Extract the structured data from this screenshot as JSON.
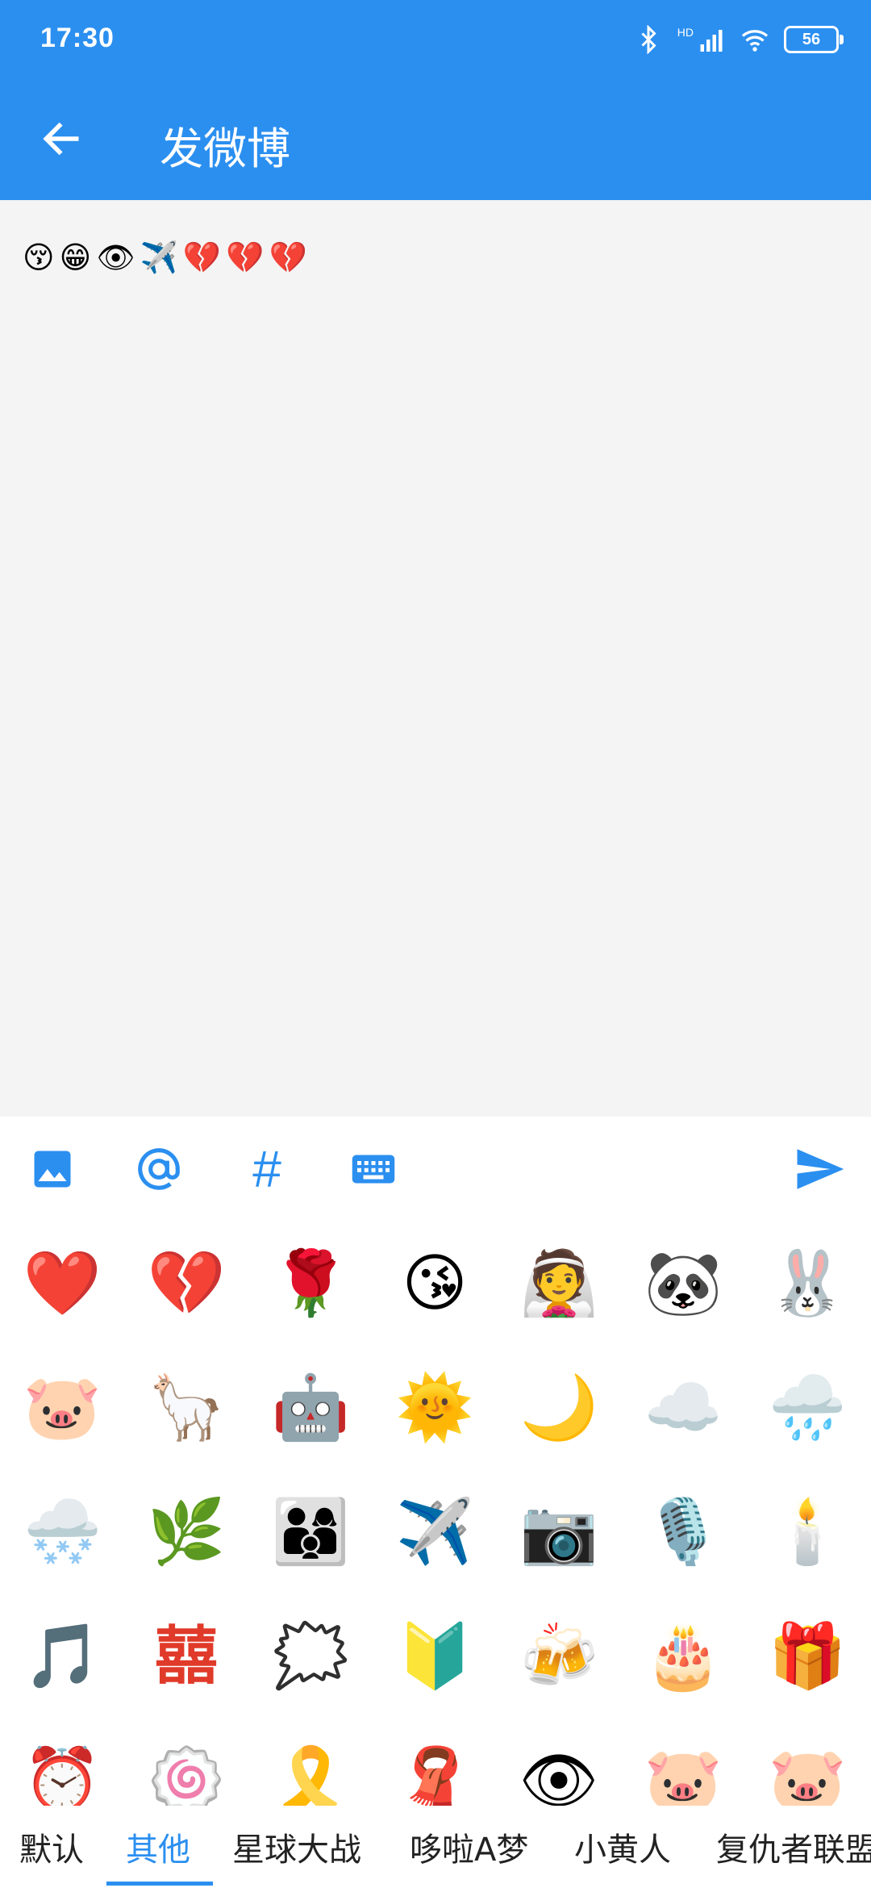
{
  "status_bar": {
    "time": "17:30",
    "hd_label": "HD",
    "battery": "56"
  },
  "header": {
    "title": "发微博"
  },
  "compose": {
    "emojis": [
      "😚",
      "😁",
      "👁",
      "✈️",
      "💔",
      "💔",
      "💔"
    ]
  },
  "toolbar": {
    "hash_label": "#"
  },
  "emoji_grid": [
    [
      "❤️",
      "💔",
      "🌹",
      "😘",
      "👰",
      "🐼",
      "🐰"
    ],
    [
      "🐷",
      "🦙",
      "🤖",
      "🌞",
      "🌙",
      "☁️",
      "🌧️"
    ],
    [
      "🌨️",
      "🌿",
      "👨‍👩‍👦",
      "✈️",
      "📷",
      "🎙️",
      "🕯️"
    ],
    [
      "🎵",
      "囍",
      "🗯️",
      "🔰",
      "🍻",
      "🎂",
      "🎁"
    ],
    [
      "⏰",
      "🍥",
      "🎗️",
      "🧣",
      "👁",
      "🐷",
      "🐷"
    ]
  ],
  "tabs": [
    "默认",
    "其他",
    "星球大战",
    "哆啦A梦",
    "小黄人",
    "复仇者联盟"
  ],
  "colors": {
    "accent": "#2b8ff0",
    "background": "#f4f4f4"
  }
}
